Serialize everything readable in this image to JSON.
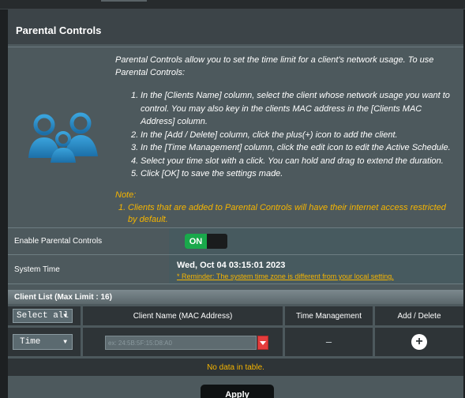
{
  "header": {
    "title": "Parental Controls"
  },
  "intro": "Parental Controls allow you to set the time limit for a client's network usage. To use Parental Controls:",
  "steps": [
    {
      "num": "1.",
      "text": "In the [Clients Name] column, select the client whose network usage you want to control. You may also key in the clients MAC address in the [Clients MAC Address] column."
    },
    {
      "num": "2.",
      "text": "In the [Add / Delete] column, click the plus(+) icon to add the client."
    },
    {
      "num": "3.",
      "text": "In the [Time Management] column, click the edit icon to edit the Active Schedule."
    },
    {
      "num": "4.",
      "text": "Select your time slot with a click. You can hold and drag to extend the duration."
    },
    {
      "num": "5.",
      "text": "Click [OK] to save the settings made."
    }
  ],
  "note": {
    "title": "Note:",
    "items": [
      {
        "num": "1.",
        "text": "Clients that are added to Parental Controls will have their internet access restricted by default."
      }
    ]
  },
  "enable": {
    "label": "Enable Parental Controls",
    "state": "ON"
  },
  "system_time": {
    "label": "System Time",
    "value": "Wed, Oct 04 03:15:01 2023",
    "reminder": "* Reminder: The system time zone is different from your local setting."
  },
  "client_list": {
    "title": "Client List (Max Limit : 16)",
    "columns": {
      "select": "Select all",
      "name": "Client Name (MAC Address)",
      "time": "Time Management",
      "add": "Add / Delete"
    },
    "input_row": {
      "time_value": "Time",
      "mac_placeholder": "ex: 24:5B:5F:15:D8:A0",
      "time_mgmt": "–"
    },
    "empty": "No data in table."
  },
  "apply_label": "Apply",
  "colors": {
    "accent_green": "#19a94b",
    "warning_yellow": "#f6b500",
    "panel": "#4d595d"
  }
}
